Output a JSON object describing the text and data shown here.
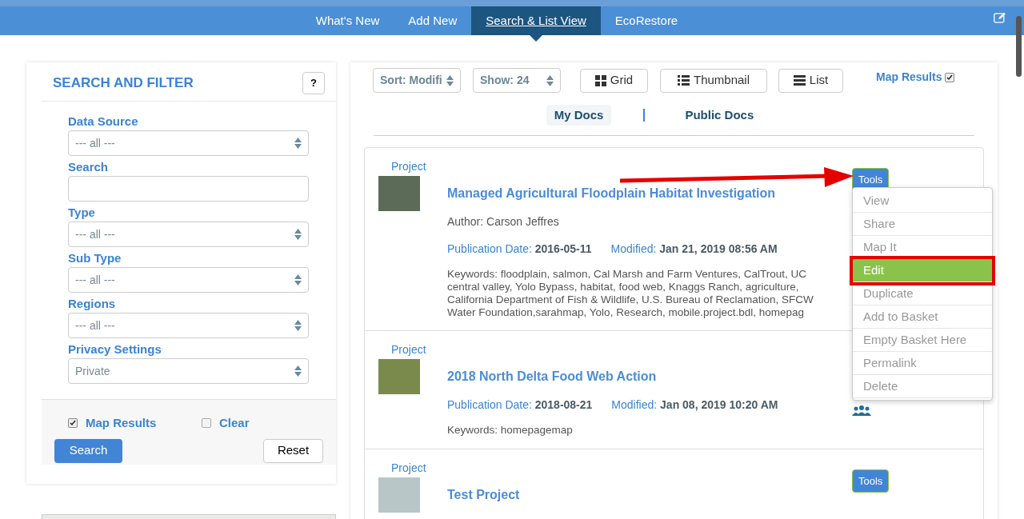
{
  "nav": {
    "tabs": [
      {
        "label": "What's New",
        "selected": false
      },
      {
        "label": "Add New",
        "selected": false
      },
      {
        "label": "Search & List View",
        "selected": true
      },
      {
        "label": "EcoRestore",
        "selected": false
      }
    ]
  },
  "filter": {
    "title": "SEARCH AND FILTER",
    "help": "?",
    "fields": [
      {
        "label": "Data Source",
        "kind": "select",
        "value": "--- all ---"
      },
      {
        "label": "Search",
        "kind": "text"
      },
      {
        "label": "Type",
        "kind": "select",
        "value": "--- all ---"
      },
      {
        "label": "Sub Type",
        "kind": "select",
        "value": "--- all ---"
      },
      {
        "label": "Regions",
        "kind": "select",
        "value": "--- all ---"
      },
      {
        "label": "Privacy Settings",
        "kind": "select",
        "value": "Private"
      }
    ],
    "checks": [
      {
        "label": "Map Results",
        "checked": true
      },
      {
        "label": "Clear",
        "checked": false
      }
    ],
    "search_button": "Search",
    "reset_button": "Reset"
  },
  "toolbar": {
    "sort": "Sort: Modifi",
    "show": "Show: 24",
    "views": [
      {
        "label": "Grid",
        "kind": "grid"
      },
      {
        "label": "Thumbnail",
        "kind": "thumbnail"
      },
      {
        "label": "List",
        "kind": "list"
      }
    ],
    "map_results": {
      "label": "Map Results",
      "checked": true
    }
  },
  "doc_tabs": [
    {
      "label": "My Docs",
      "selected": true
    },
    {
      "label": "Public Docs",
      "selected": false
    }
  ],
  "results": [
    {
      "type": "Project",
      "title": "Managed Agricultural Floodplain Habitat Investigation",
      "author": "Author: Carson Jeffres",
      "pub_label": "Publication Date:",
      "pub": "2016-05-11",
      "mod_label": "Modified:",
      "mod": "Jan 21, 2019 08:56 AM",
      "keywords": [
        "Keywords: floodplain, salmon, Cal Marsh and Farm Ventures, CalTrout, UC",
        "central valley, Yolo Bypass, habitat, food web, Knaggs Ranch, agriculture,",
        "California Department of Fish & Wildlife, U.S. Bureau of Reclamation, SFCW",
        "Water Foundation,sarahmap, Yolo, Research, mobile.project.bdl, homepag"
      ],
      "tools": "Tools",
      "menu_open": true,
      "shared": false
    },
    {
      "type": "Project",
      "title": "2018 North Delta Food Web Action",
      "pub_label": "Publication Date:",
      "pub": "2018-08-21",
      "mod_label": "Modified:",
      "mod": "Jan 08, 2019 10:20 AM",
      "keywords": [
        "Keywords: homepagemap"
      ],
      "menu_open": false,
      "shared": true
    },
    {
      "type": "Project",
      "title": "Test Project",
      "tools": "Tools",
      "menu_open": false,
      "shared": false
    }
  ],
  "tools_menu": [
    {
      "label": "View",
      "selected": false
    },
    {
      "label": "Share",
      "selected": false
    },
    {
      "label": "Map It",
      "selected": false
    },
    {
      "label": "Edit",
      "selected": true
    },
    {
      "label": "Duplicate",
      "selected": false
    },
    {
      "label": "Add to Basket",
      "selected": false
    },
    {
      "label": "Empty Basket Here",
      "selected": false
    },
    {
      "label": "Permalink",
      "selected": false
    },
    {
      "label": "Delete",
      "selected": false
    }
  ]
}
